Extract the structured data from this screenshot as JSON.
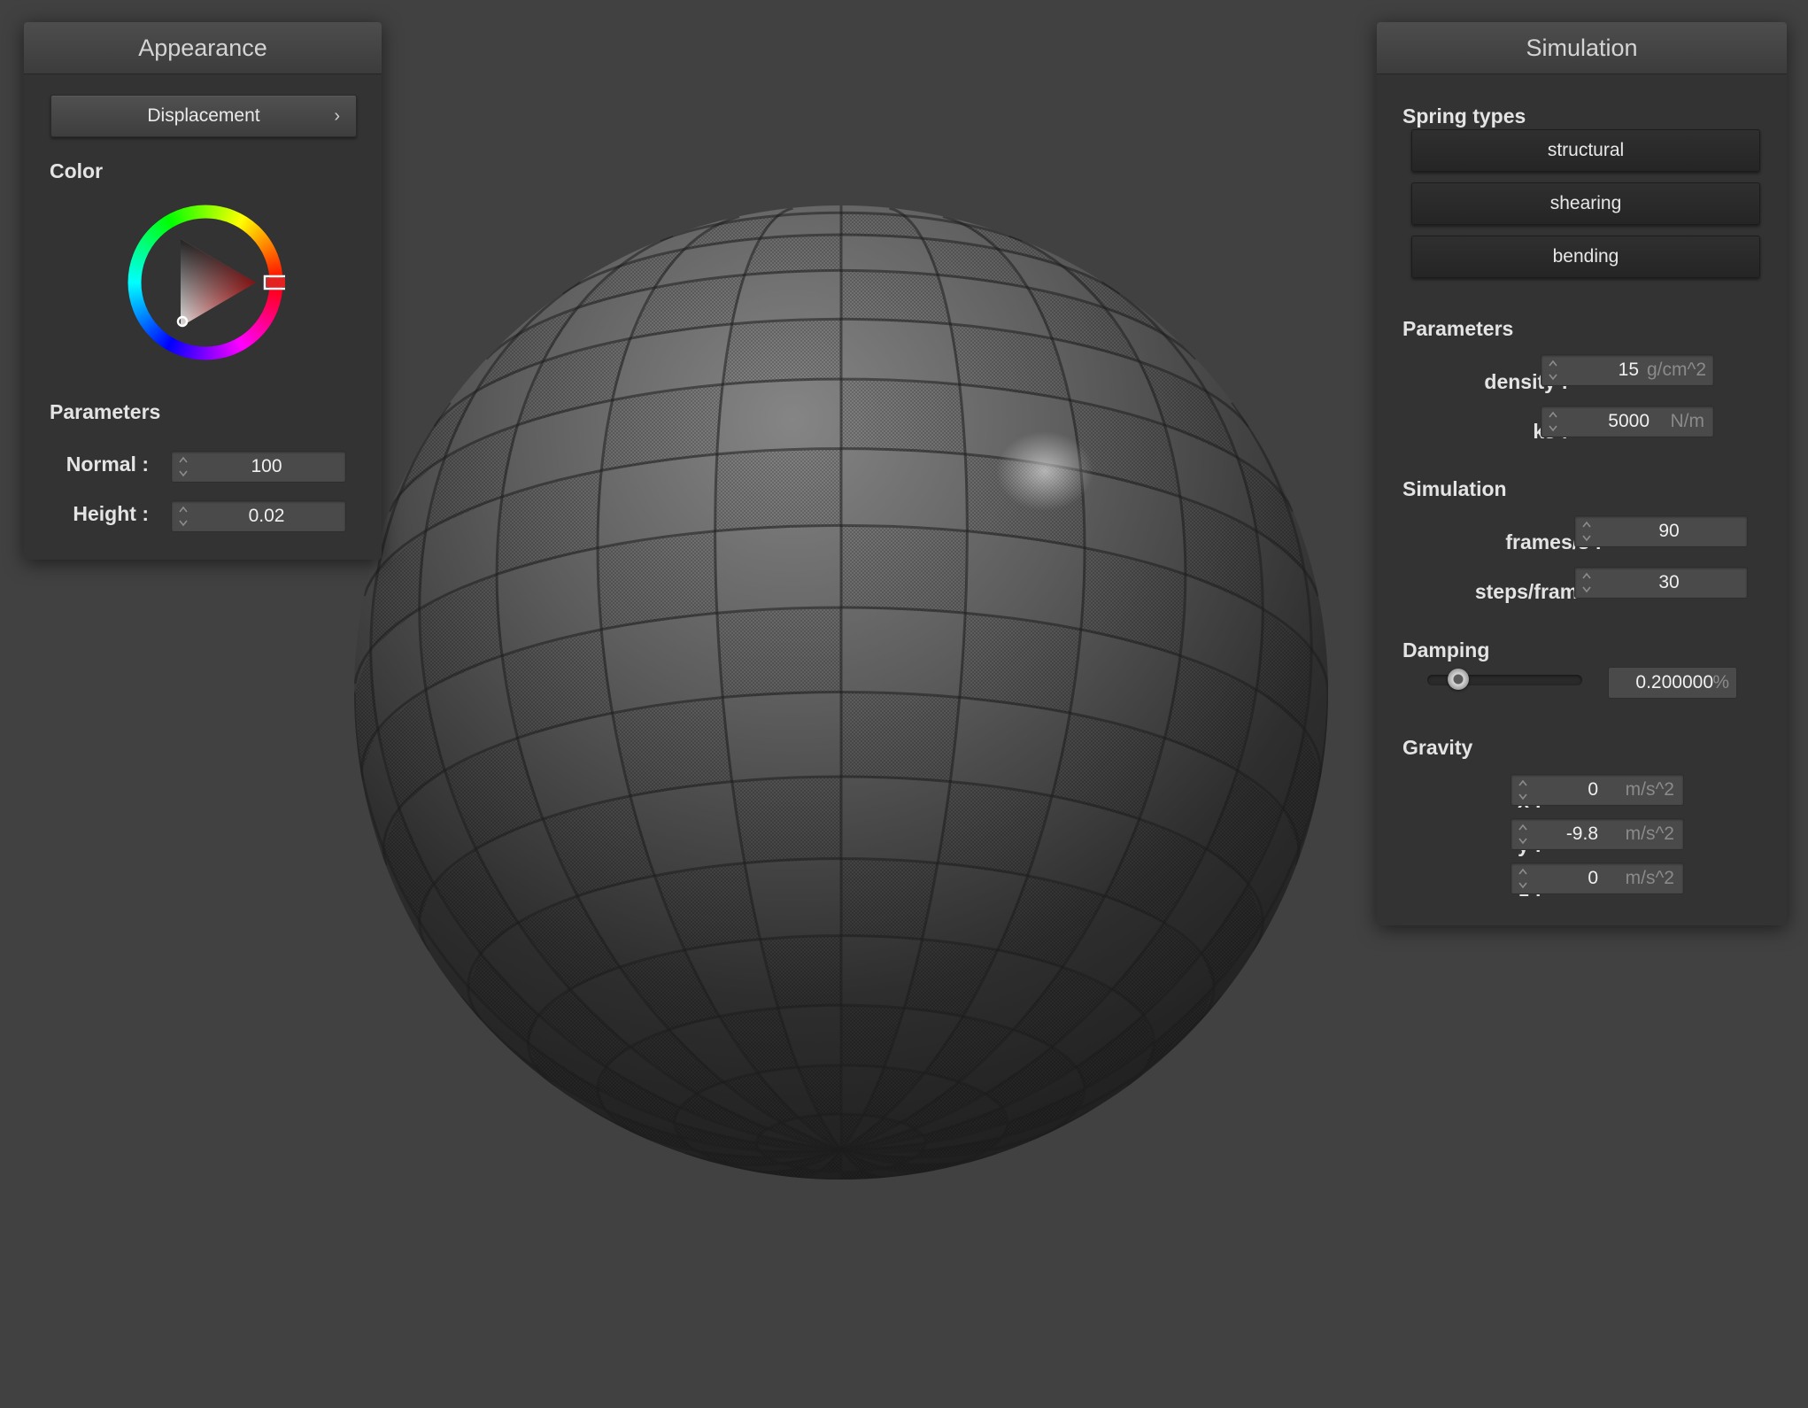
{
  "appearance": {
    "title": "Appearance",
    "shader_select": {
      "label": "Displacement",
      "chevron": "›"
    },
    "color_label": "Color",
    "color_wheel": {
      "selected_color": "#cc1f1f",
      "icon": "color-wheel-icon"
    },
    "parameters_label": "Parameters",
    "fields": [
      {
        "label": "Normal :",
        "value": "100"
      },
      {
        "label": "Height :",
        "value": "0.02"
      }
    ]
  },
  "simulation": {
    "title": "Simulation",
    "spring_types_label": "Spring types",
    "spring_types": [
      "structural",
      "shearing",
      "bending"
    ],
    "parameters_label": "Parameters",
    "parameters": [
      {
        "label": "density :",
        "value": "15",
        "unit": "g/cm^2"
      },
      {
        "label": "ks :",
        "value": "5000",
        "unit": "N/m"
      }
    ],
    "simulation_label": "Simulation",
    "simulation_fields": [
      {
        "label": "frames/s :",
        "value": "90"
      },
      {
        "label": "steps/frame :",
        "value": "30"
      }
    ],
    "damping_label": "Damping",
    "damping": {
      "value": "0.200000",
      "unit": "%",
      "slider_fraction": 0.2
    },
    "gravity_label": "Gravity",
    "gravity": [
      {
        "label": "x :",
        "value": "0",
        "unit": "m/s^2"
      },
      {
        "label": "y :",
        "value": "-9.8",
        "unit": "m/s^2"
      },
      {
        "label": "z :",
        "value": "0",
        "unit": "m/s^2"
      }
    ]
  },
  "colors": {
    "background": "#414141",
    "panel": "#333333",
    "accent_red": "#e32222"
  }
}
